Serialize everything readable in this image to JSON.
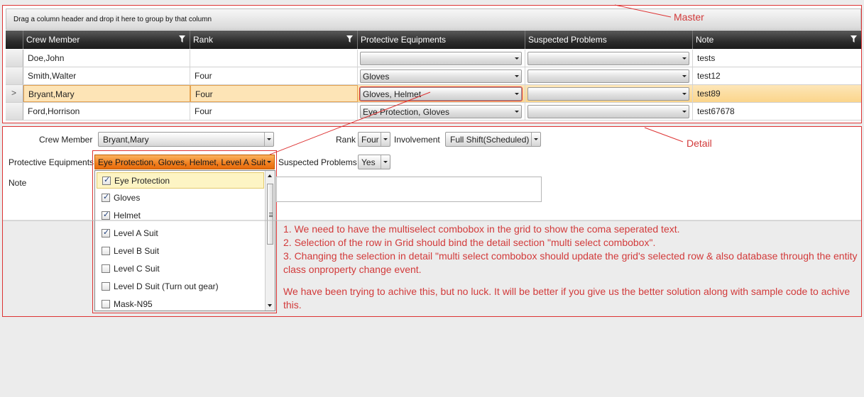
{
  "master": {
    "label": "Master",
    "group_panel_hint": "Drag a column header and drop it here to group by that column",
    "columns": [
      {
        "label": "Crew Member",
        "filter": true
      },
      {
        "label": "Rank",
        "filter": true
      },
      {
        "label": "Protective Equipments",
        "filter": false
      },
      {
        "label": "Suspected Problems",
        "filter": false
      },
      {
        "label": "Note",
        "filter": true
      }
    ],
    "rows": [
      {
        "indicator": "",
        "crew_member": "Doe,John",
        "rank": "",
        "protective": "",
        "suspected": "",
        "note": "tests",
        "selected": false
      },
      {
        "indicator": "",
        "crew_member": "Smith,Walter",
        "rank": "Four",
        "protective": "Gloves",
        "suspected": "",
        "note": "test12",
        "selected": false
      },
      {
        "indicator": ">",
        "crew_member": "Bryant,Mary",
        "rank": "Four",
        "protective": "Gloves, Helmet",
        "suspected": "",
        "note": "test89",
        "selected": true
      },
      {
        "indicator": "",
        "crew_member": "Ford,Horrison",
        "rank": "Four",
        "protective": "Eye Protection, Gloves",
        "suspected": "",
        "note": "test67678",
        "selected": false
      }
    ]
  },
  "detail": {
    "label": "Detail",
    "crew_member_label": "Crew Member",
    "crew_member_value": "Bryant,Mary",
    "rank_label": "Rank",
    "rank_value": "Four",
    "involvement_label": "Involvement",
    "involvement_value": "Full Shift(Scheduled)",
    "protective_label": "Protective Equipments",
    "protective_value": "Eye Protection, Gloves, Helmet, Level A Suit",
    "suspected_label": "Suspected Problems",
    "suspected_value": "Yes",
    "note_label": "Note",
    "note_value": "",
    "options": [
      {
        "label": "Eye Protection",
        "checked": true,
        "hover": true
      },
      {
        "label": "Gloves",
        "checked": true,
        "hover": false
      },
      {
        "label": "Helmet",
        "checked": true,
        "hover": false
      },
      {
        "label": "Level A Suit",
        "checked": true,
        "hover": false
      },
      {
        "label": "Level B Suit",
        "checked": false,
        "hover": false
      },
      {
        "label": "Level C Suit",
        "checked": false,
        "hover": false
      },
      {
        "label": "Level D Suit (Turn out gear)",
        "checked": false,
        "hover": false
      },
      {
        "label": "Mask-N95",
        "checked": false,
        "hover": false
      }
    ]
  },
  "annotations": [
    "1. We need to have the multiselect combobox in the grid to show the coma seperated text.",
    "2. Selection of the row in Grid should bind the detail section \"multi select combobox\".",
    "3. Changing the selection in detail \"multi select combobox should update the grid's selected row & also database through the entity class onproperty change event.",
    "We have been trying to achive this, but no luck. It will be better if you give us the better solution along with sample code to achive this."
  ],
  "colors": {
    "annotation": "#d23a3a",
    "selected_row": "#fbd58b",
    "active_combo": "#f07f1f"
  }
}
